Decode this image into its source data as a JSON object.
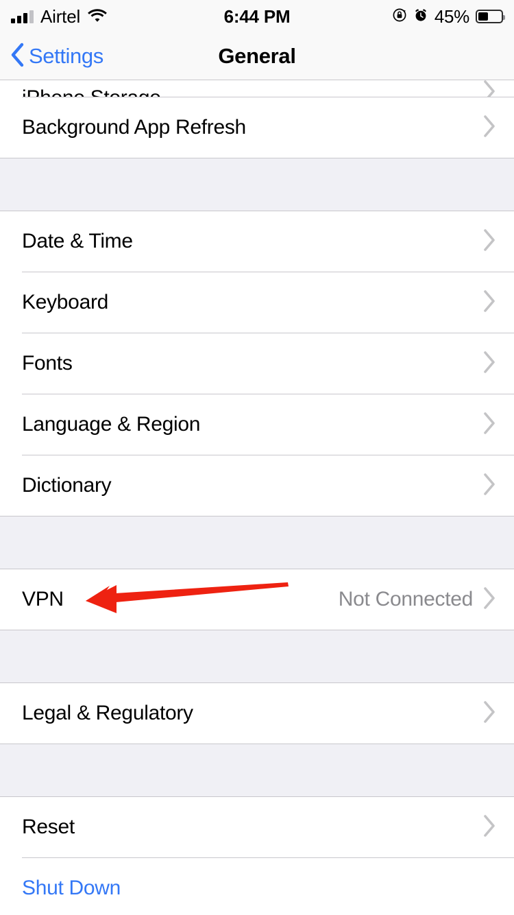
{
  "status_bar": {
    "carrier": "Airtel",
    "wifi_icon": "wifi-icon",
    "signal_icon": "cellular-signal-icon",
    "time": "6:44 PM",
    "rotation_lock_icon": "rotation-lock-icon",
    "alarm_icon": "alarm-clock-icon",
    "battery_percent": "45%",
    "battery_level": 45
  },
  "nav": {
    "back_label": "Settings",
    "back_icon": "chevron-left-icon",
    "title": "General"
  },
  "colors": {
    "accent_blue": "#3478F6",
    "separator": "#C8C7CC",
    "group_background": "#F0F0F5",
    "secondary_text": "#8A8A8E",
    "chevron": "#C4C4C6",
    "annotation_red": "#EE2211"
  },
  "sections": [
    {
      "name": "storage-section",
      "clipped_top": true,
      "rows": [
        {
          "label": "iPhone Storage",
          "value": "",
          "accessory": "chevron-right-icon",
          "clipped": true
        },
        {
          "label": "Background App Refresh",
          "value": "",
          "accessory": "chevron-right-icon",
          "clipped": false
        }
      ]
    },
    {
      "name": "localization-section",
      "clipped_top": false,
      "rows": [
        {
          "label": "Date & Time",
          "value": "",
          "accessory": "chevron-right-icon",
          "clipped": false
        },
        {
          "label": "Keyboard",
          "value": "",
          "accessory": "chevron-right-icon",
          "clipped": false
        },
        {
          "label": "Fonts",
          "value": "",
          "accessory": "chevron-right-icon",
          "clipped": false
        },
        {
          "label": "Language & Region",
          "value": "",
          "accessory": "chevron-right-icon",
          "clipped": false
        },
        {
          "label": "Dictionary",
          "value": "",
          "accessory": "chevron-right-icon",
          "clipped": false
        }
      ]
    },
    {
      "name": "vpn-section",
      "clipped_top": false,
      "rows": [
        {
          "label": "VPN",
          "value": "Not Connected",
          "accessory": "chevron-right-icon",
          "clipped": false
        }
      ]
    },
    {
      "name": "legal-section",
      "clipped_top": false,
      "rows": [
        {
          "label": "Legal & Regulatory",
          "value": "",
          "accessory": "chevron-right-icon",
          "clipped": false
        }
      ]
    },
    {
      "name": "reset-section",
      "clipped_top": false,
      "rows": [
        {
          "label": "Reset",
          "value": "",
          "accessory": "chevron-right-icon",
          "clipped": false
        },
        {
          "label": "Shut Down",
          "value": "",
          "accessory": "",
          "clipped": false,
          "style": "blue"
        }
      ]
    }
  ],
  "annotation": {
    "type": "arrow",
    "points_to": "VPN",
    "color": "#EE2211",
    "direction": "left"
  }
}
